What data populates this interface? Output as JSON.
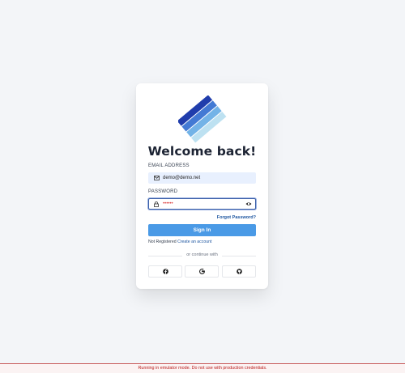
{
  "login": {
    "title": "Welcome back!",
    "email_label": "EMAIL ADDRESS",
    "email_value": "demo@demo.net",
    "password_label": "PASSWORD",
    "password_value": "••••••",
    "forgot_label": "Forgot Password?",
    "signin_label": "Sign In",
    "not_registered": "Not Registered",
    "create_account": "Create an account",
    "continue_with": "or continue with",
    "social": [
      "facebook-icon",
      "google-icon",
      "github-icon"
    ]
  },
  "banner": {
    "text": "Running in emulator mode. Do not use with production credentials."
  },
  "colors": {
    "accent": "#4a9ae6",
    "link": "#1e56a0",
    "banner_text": "#b91c1c",
    "logo_dark": "#1433a8",
    "logo_mid": "#5aa6e3",
    "logo_light": "#b6def0"
  }
}
